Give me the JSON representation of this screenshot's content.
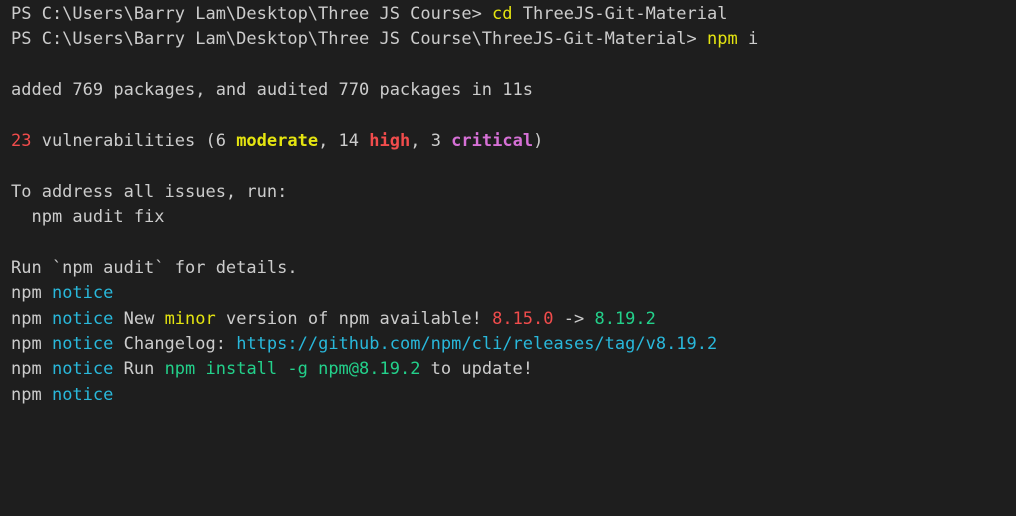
{
  "terminal": {
    "lines": [
      {
        "segments": [
          {
            "text": "PS C:\\Users\\Barry Lam\\Desktop\\Three JS Course> ",
            "color": ""
          },
          {
            "text": "cd",
            "color": "yellow"
          },
          {
            "text": " ThreeJS-Git-Material",
            "color": ""
          }
        ]
      },
      {
        "segments": [
          {
            "text": "PS C:\\Users\\Barry Lam\\Desktop\\Three JS Course\\ThreeJS-Git-Material> ",
            "color": ""
          },
          {
            "text": "npm",
            "color": "yellow"
          },
          {
            "text": " i",
            "color": ""
          }
        ]
      },
      {
        "segments": []
      },
      {
        "segments": [
          {
            "text": "added 769 packages, and audited 770 packages in 11s",
            "color": ""
          }
        ]
      },
      {
        "segments": []
      },
      {
        "segments": [
          {
            "text": "23",
            "color": "red"
          },
          {
            "text": " vulnerabilities (6 ",
            "color": ""
          },
          {
            "text": "moderate",
            "color": "yellow bold"
          },
          {
            "text": ", 14 ",
            "color": ""
          },
          {
            "text": "high",
            "color": "red bold"
          },
          {
            "text": ", 3 ",
            "color": ""
          },
          {
            "text": "critical",
            "color": "magenta bold"
          },
          {
            "text": ")",
            "color": ""
          }
        ]
      },
      {
        "segments": []
      },
      {
        "segments": [
          {
            "text": "To address all issues, run:",
            "color": ""
          }
        ]
      },
      {
        "segments": [
          {
            "text": "  npm audit fix",
            "color": ""
          }
        ]
      },
      {
        "segments": []
      },
      {
        "segments": [
          {
            "text": "Run `npm audit` for details.",
            "color": ""
          }
        ]
      },
      {
        "segments": [
          {
            "text": "npm ",
            "color": ""
          },
          {
            "text": "notice",
            "color": "cyan"
          }
        ]
      },
      {
        "segments": [
          {
            "text": "npm ",
            "color": ""
          },
          {
            "text": "notice",
            "color": "cyan"
          },
          {
            "text": " New ",
            "color": ""
          },
          {
            "text": "minor",
            "color": "yellow"
          },
          {
            "text": " version of npm available! ",
            "color": ""
          },
          {
            "text": "8.15.0",
            "color": "red"
          },
          {
            "text": " -> ",
            "color": ""
          },
          {
            "text": "8.19.2",
            "color": "green"
          }
        ]
      },
      {
        "segments": [
          {
            "text": "npm ",
            "color": ""
          },
          {
            "text": "notice",
            "color": "cyan"
          },
          {
            "text": " Changelog: ",
            "color": ""
          },
          {
            "text": "https://github.com/npm/cli/releases/tag/v8.19.2",
            "color": "cyan"
          }
        ]
      },
      {
        "segments": [
          {
            "text": "npm ",
            "color": ""
          },
          {
            "text": "notice",
            "color": "cyan"
          },
          {
            "text": " Run ",
            "color": ""
          },
          {
            "text": "npm install -g npm@8.19.2",
            "color": "green"
          },
          {
            "text": " to update!",
            "color": ""
          }
        ]
      },
      {
        "segments": [
          {
            "text": "npm ",
            "color": ""
          },
          {
            "text": "notice",
            "color": "cyan"
          }
        ]
      }
    ],
    "colors": {
      "background": "#1e1e1e",
      "foreground": "#cccccc",
      "yellow": "#e5e510",
      "red": "#f14c4c",
      "magenta": "#d670d6",
      "cyan": "#29b8db",
      "green": "#23d18b"
    }
  }
}
